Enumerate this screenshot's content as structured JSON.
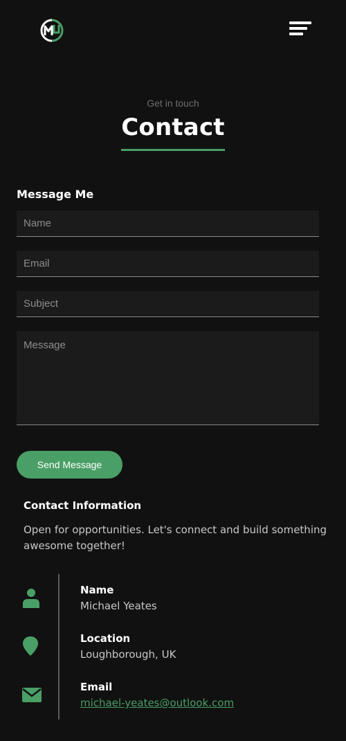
{
  "header": {
    "logo_icon": "mb-monogram-logo",
    "menu_icon": "hamburger-menu-icon"
  },
  "section": {
    "kicker": "Get in touch",
    "title": "Contact"
  },
  "form": {
    "heading": "Message Me",
    "name_placeholder": "Name",
    "email_placeholder": "Email",
    "subject_placeholder": "Subject",
    "message_placeholder": "Message",
    "name_value": "",
    "email_value": "",
    "subject_value": "",
    "message_value": "",
    "submit_label": "Send Message"
  },
  "info": {
    "heading": "Contact Information",
    "description": "Open for opportunities. Let's connect and build something awesome together!",
    "items": [
      {
        "icon": "person-icon",
        "label": "Name",
        "value": "Michael Yeates"
      },
      {
        "icon": "location-pin-icon",
        "label": "Location",
        "value": "Loughborough, UK"
      },
      {
        "icon": "envelope-icon",
        "label": "Email",
        "value": "michael-yeates@outlook.com"
      }
    ]
  },
  "colors": {
    "background": "#111111",
    "accent": "#4a9f66",
    "field_background": "#1b1b1b",
    "muted_text": "#c8c8c8"
  }
}
